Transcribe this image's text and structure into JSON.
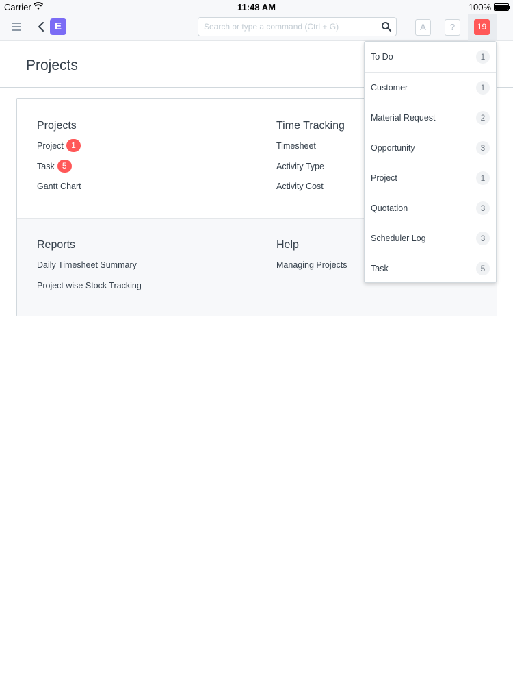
{
  "status_bar": {
    "carrier": "Carrier",
    "time": "11:48 AM",
    "battery": "100%"
  },
  "navbar": {
    "brand_letter": "E",
    "search_placeholder": "Search or type a command (Ctrl + G)",
    "avatar_letter": "A",
    "help_label": "?",
    "notification_count": "19"
  },
  "page": {
    "title": "Projects"
  },
  "modules": {
    "projects": {
      "title": "Projects",
      "links": [
        {
          "label": "Project",
          "count": "1"
        },
        {
          "label": "Task",
          "count": "5"
        },
        {
          "label": "Gantt Chart"
        }
      ]
    },
    "time_tracking": {
      "title": "Time Tracking",
      "links": [
        {
          "label": "Timesheet"
        },
        {
          "label": "Activity Type"
        },
        {
          "label": "Activity Cost"
        }
      ]
    },
    "reports": {
      "title": "Reports",
      "links": [
        {
          "label": "Daily Timesheet Summary"
        },
        {
          "label": "Project wise Stock Tracking"
        }
      ]
    },
    "help": {
      "title": "Help",
      "links": [
        {
          "label": "Managing Projects"
        }
      ]
    }
  },
  "notifications": {
    "items": [
      {
        "label": "To Do",
        "count": "1"
      },
      {
        "label": "Customer",
        "count": "1"
      },
      {
        "label": "Material Request",
        "count": "2"
      },
      {
        "label": "Opportunity",
        "count": "3"
      },
      {
        "label": "Project",
        "count": "1"
      },
      {
        "label": "Quotation",
        "count": "3"
      },
      {
        "label": "Scheduler Log",
        "count": "3"
      },
      {
        "label": "Task",
        "count": "5"
      }
    ]
  },
  "colors": {
    "accent": "#7b6cf5",
    "alert": "#ff5858",
    "text": "#36414c",
    "muted": "#8d99a6"
  }
}
